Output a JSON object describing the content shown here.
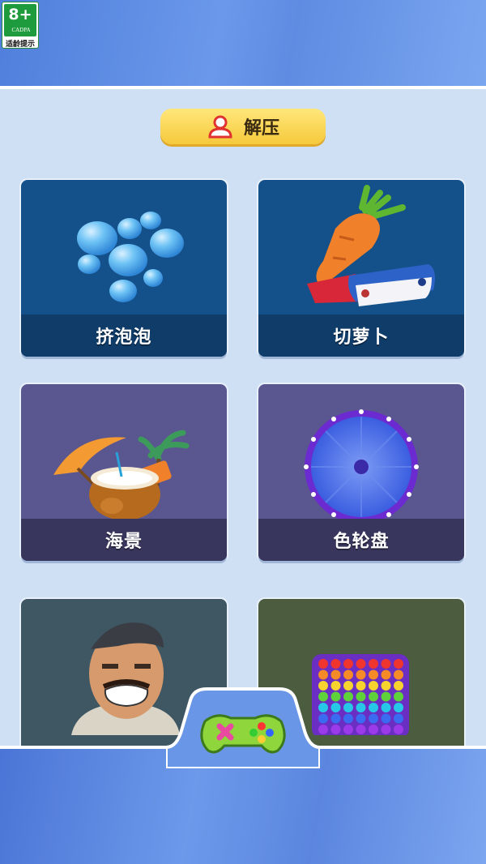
{
  "age_rating": {
    "number": "8+",
    "org": "CADPA",
    "tip": "适龄提示"
  },
  "category": {
    "title": "解压",
    "icon": "user-icon"
  },
  "cards": [
    {
      "label": "挤泡泡",
      "icon": "bubbles-icon",
      "bg": "#14518a",
      "bar": "#0f3c69"
    },
    {
      "label": "切萝卜",
      "icon": "carrot-icon",
      "bg": "#14518a",
      "bar": "#0f3c69"
    },
    {
      "label": "海景",
      "icon": "coconut-beach-icon",
      "bg": "#5a5690",
      "bar": "#38365c"
    },
    {
      "label": "色轮盘",
      "icon": "wheel-icon",
      "bg": "#5a5690",
      "bar": "#38365c"
    },
    {
      "label": "",
      "icon": "man-face-icon",
      "bg": "#3f5663"
    },
    {
      "label": "",
      "icon": "pop-it-icon",
      "bg": "#4c5c3f"
    }
  ],
  "nav": {
    "center_icon": "gamepad-icon"
  }
}
